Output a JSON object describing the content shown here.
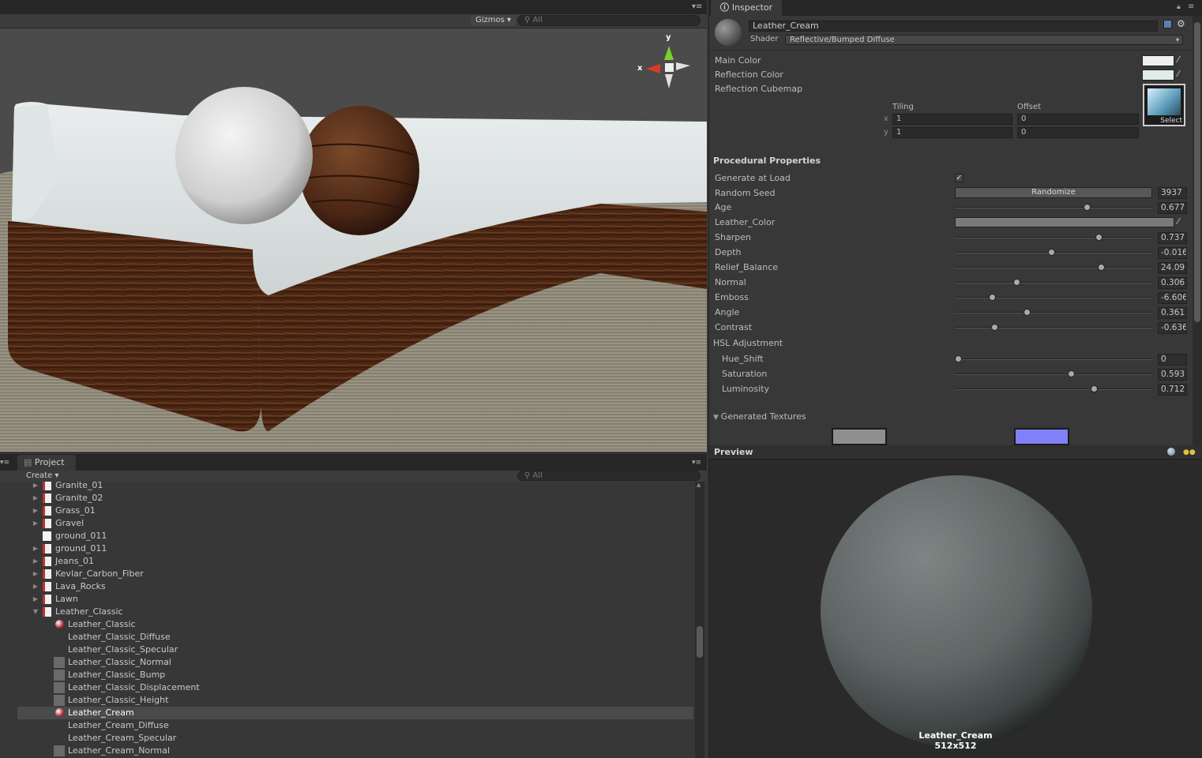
{
  "scene": {
    "gizmos_label": "Gizmos ▾",
    "search_placeholder": "All",
    "axis_y": "y",
    "axis_x": "x"
  },
  "inspector": {
    "tab_label": "Inspector",
    "material_name": "Leather_Cream",
    "shader_label": "Shader",
    "shader_value": "Reflective/Bumped Diffuse",
    "main_color": "Main Color",
    "reflection_color": "Reflection Color",
    "reflection_cubemap": "Reflection Cubemap",
    "tiling": "Tiling",
    "offset": "Offset",
    "x": "x",
    "y": "y",
    "tiling_x": "1",
    "tiling_y": "1",
    "offset_x": "0",
    "offset_y": "0",
    "select": "Select",
    "procedural": "Procedural Properties",
    "generate_at_load": "Generate at Load",
    "random_seed": "Random Seed",
    "randomize": "Randomize",
    "seed_value": "3937",
    "sliders": [
      {
        "label": "Age",
        "value": "0.677",
        "pos": 0.677
      },
      {
        "label": "Sharpen",
        "value": "0.737",
        "pos": 0.737
      },
      {
        "label": "Depth",
        "value": "-0.016",
        "pos": 0.49
      },
      {
        "label": "Relief_Balance",
        "value": "24.09",
        "pos": 0.75
      },
      {
        "label": "Normal",
        "value": "0.306",
        "pos": 0.306
      },
      {
        "label": "Emboss",
        "value": "-6.606",
        "pos": 0.18
      },
      {
        "label": "Angle",
        "value": "0.361",
        "pos": 0.361
      },
      {
        "label": "Contrast",
        "value": "-0.636",
        "pos": 0.19
      }
    ],
    "leather_color": "Leather_Color",
    "hsl": "HSL Adjustment",
    "hsl_sliders": [
      {
        "label": "Hue_Shift",
        "value": "0",
        "pos": 0.0
      },
      {
        "label": "Saturation",
        "value": "0.593",
        "pos": 0.593
      },
      {
        "label": "Luminosity",
        "value": "0.712",
        "pos": 0.712
      }
    ],
    "generated_textures": "Generated Textures"
  },
  "preview": {
    "label": "Preview",
    "name": "Leather_Cream",
    "size": "512x512"
  },
  "project": {
    "tab_label": "Project",
    "create": "Create ▾",
    "search_placeholder": "All",
    "items": [
      {
        "name": "Granite_01",
        "indent": 0,
        "arrow": "▶",
        "icon": "sbsar"
      },
      {
        "name": "Granite_02",
        "indent": 0,
        "arrow": "▶",
        "icon": "sbsar"
      },
      {
        "name": "Grass_01",
        "indent": 0,
        "arrow": "▶",
        "icon": "sbsar"
      },
      {
        "name": "Gravel",
        "indent": 0,
        "arrow": "▶",
        "icon": "sbsar"
      },
      {
        "name": "ground_011",
        "indent": 0,
        "arrow": "",
        "icon": "file"
      },
      {
        "name": "ground_011",
        "indent": 0,
        "arrow": "▶",
        "icon": "sbsar"
      },
      {
        "name": "Jeans_01",
        "indent": 0,
        "arrow": "▶",
        "icon": "sbsar"
      },
      {
        "name": "Kevlar_Carbon_Fiber",
        "indent": 0,
        "arrow": "▶",
        "icon": "sbsar"
      },
      {
        "name": "Lava_Rocks",
        "indent": 0,
        "arrow": "▶",
        "icon": "sbsar"
      },
      {
        "name": "Lawn",
        "indent": 0,
        "arrow": "▶",
        "icon": "sbsar"
      },
      {
        "name": "Leather_Classic",
        "indent": 0,
        "arrow": "▼",
        "icon": "sbsar"
      },
      {
        "name": "Leather_Classic",
        "indent": 1,
        "arrow": "",
        "icon": "material"
      },
      {
        "name": "Leather_Classic_Diffuse",
        "indent": 1,
        "arrow": "",
        "icon": "none"
      },
      {
        "name": "Leather_Classic_Specular",
        "indent": 1,
        "arrow": "",
        "icon": "none"
      },
      {
        "name": "Leather_Classic_Normal",
        "indent": 1,
        "arrow": "",
        "icon": "tex"
      },
      {
        "name": "Leather_Classic_Bump",
        "indent": 1,
        "arrow": "",
        "icon": "tex"
      },
      {
        "name": "Leather_Classic_Displacement",
        "indent": 1,
        "arrow": "",
        "icon": "tex"
      },
      {
        "name": "Leather_Classic_Height",
        "indent": 1,
        "arrow": "",
        "icon": "tex"
      },
      {
        "name": "Leather_Cream",
        "indent": 1,
        "arrow": "",
        "icon": "material",
        "selected": true
      },
      {
        "name": "Leather_Cream_Diffuse",
        "indent": 1,
        "arrow": "",
        "icon": "none"
      },
      {
        "name": "Leather_Cream_Specular",
        "indent": 1,
        "arrow": "",
        "icon": "none"
      },
      {
        "name": "Leather_Cream_Normal",
        "indent": 1,
        "arrow": "",
        "icon": "tex"
      }
    ]
  }
}
